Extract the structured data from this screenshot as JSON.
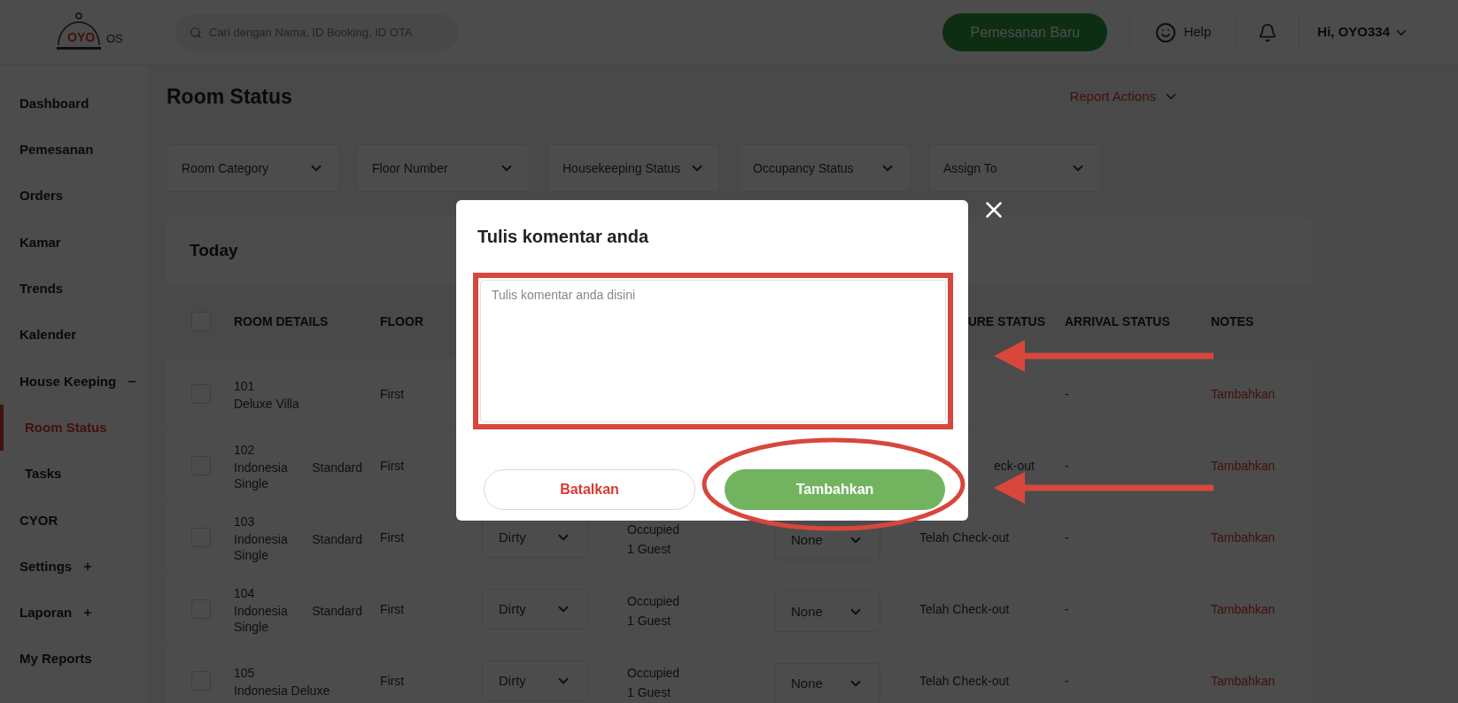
{
  "header": {
    "logo": {
      "brand": "OYO",
      "suffix": "OS"
    },
    "search": {
      "placeholder": "Cari dengan Nama, ID Booking, ID OTA"
    },
    "new_booking": "Pemesanan Baru",
    "help": "Help",
    "user": "Hi, OYO334"
  },
  "sidebar": {
    "items": [
      {
        "label": "Dashboard",
        "selected": false
      },
      {
        "label": "Pemesanan",
        "selected": false
      },
      {
        "label": "Orders",
        "selected": false
      },
      {
        "label": "Kamar",
        "selected": false
      },
      {
        "label": "Trends",
        "selected": false
      },
      {
        "label": "Kalender",
        "selected": false
      },
      {
        "label": "House Keeping",
        "selected": false,
        "expanded": true,
        "children": [
          {
            "label": "Room Status",
            "selected": true
          },
          {
            "label": "Tasks",
            "selected": false
          }
        ]
      },
      {
        "label": "CYOR",
        "selected": false
      },
      {
        "label": "Settings",
        "selected": false,
        "expanded": false
      },
      {
        "label": "Laporan",
        "selected": false,
        "expanded": false
      },
      {
        "label": "My Reports",
        "selected": false
      }
    ]
  },
  "page": {
    "title": "Room Status",
    "report_actions": "Report Actions",
    "filters": [
      "Room Category",
      "Floor Number",
      "Housekeeping Status",
      "Occupancy Status",
      "Assign To"
    ]
  },
  "table": {
    "title": "Today",
    "header_checked": false,
    "columns": {
      "room_details": "ROOM DETAILS",
      "floor": "FLOOR",
      "departure": "URE STATUS",
      "arrival": "ARRIVAL STATUS",
      "notes": "NOTES"
    },
    "rows": [
      {
        "checked": false,
        "number": "101",
        "type": "Deluxe Villa",
        "floor": "First",
        "arrival": "-",
        "note": "Tambahkan"
      },
      {
        "checked": false,
        "number": "102",
        "type": "Indonesia Standard Single",
        "floor": "First",
        "departure": "eck-out",
        "arrival": "-",
        "note": "Tambahkan"
      },
      {
        "checked": false,
        "number": "103",
        "type": "Indonesia Standard Single",
        "floor": "First",
        "housekeeping": "Dirty",
        "occupancy": [
          "Occupied",
          "1 Guest"
        ],
        "assign": "None",
        "departure": "Telah Check-out",
        "arrival": "-",
        "note": "Tambahkan"
      },
      {
        "checked": false,
        "number": "104",
        "type": "Indonesia Standard Single",
        "floor": "First",
        "housekeeping": "Dirty",
        "occupancy": [
          "Occupied",
          "1 Guest"
        ],
        "assign": "None",
        "departure": "Telah Check-out",
        "arrival": "-",
        "note": "Tambahkan"
      },
      {
        "checked": false,
        "number": "105",
        "type": "Indonesia Deluxe",
        "floor": "First",
        "housekeeping": "Dirty",
        "occupancy": [
          "Occupied",
          "1 Guest"
        ],
        "assign": "None",
        "departure": "Telah Check-out",
        "arrival": "-",
        "note": "Tambahkan"
      }
    ]
  },
  "modal": {
    "title": "Tulis komentar anda",
    "comment": {
      "placeholder": "Tulis komentar anda disini"
    },
    "buttons": [
      {
        "label": "Batalkan",
        "kind": "secondary"
      },
      {
        "label": "Tambahkan",
        "kind": "primary"
      }
    ]
  }
}
